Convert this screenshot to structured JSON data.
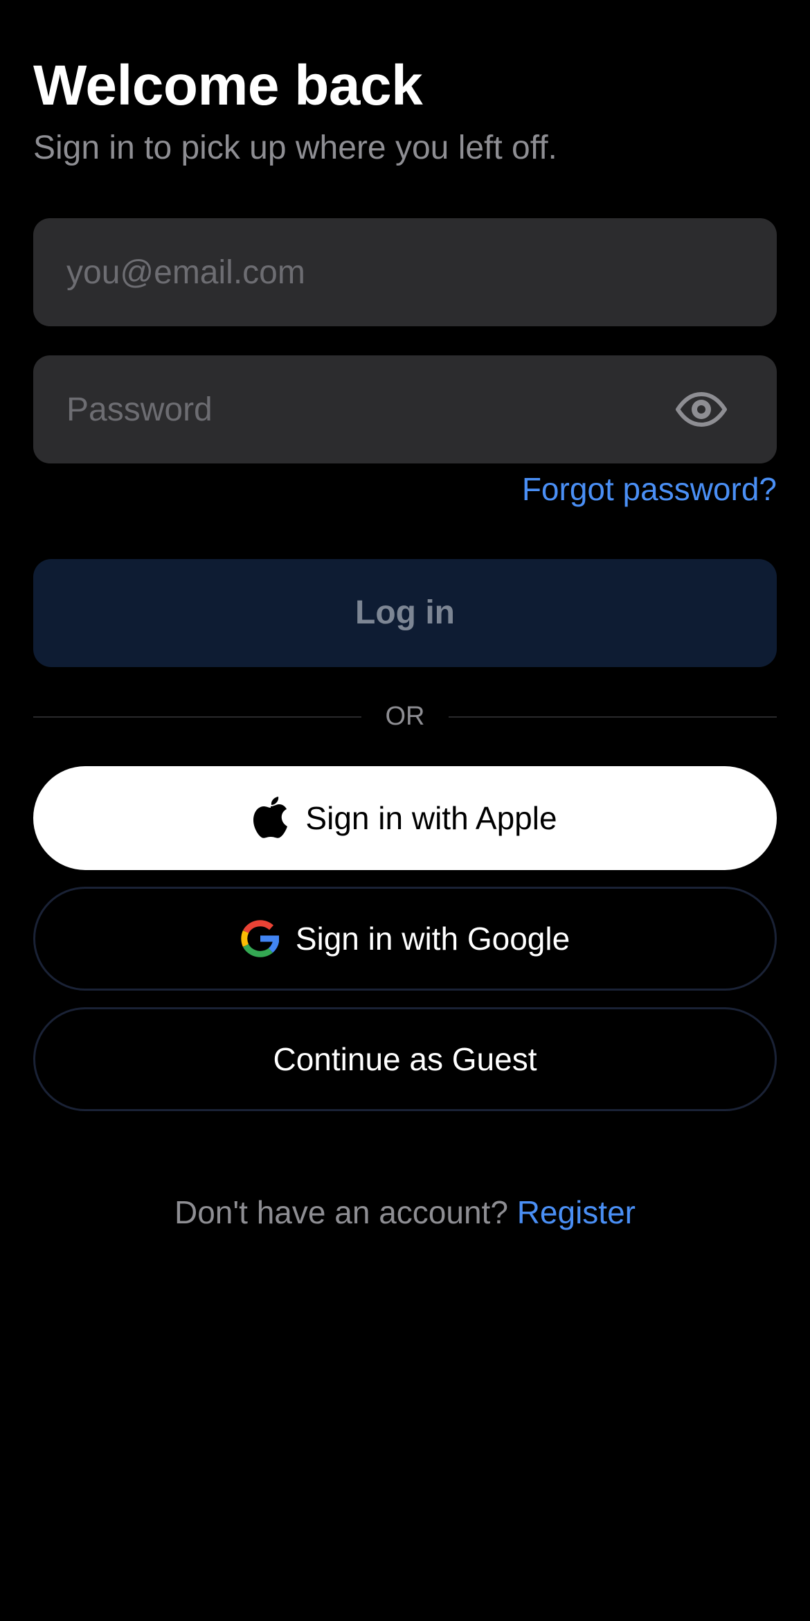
{
  "header": {
    "title": "Welcome back",
    "subtitle": "Sign in to pick up where you left off."
  },
  "form": {
    "email_placeholder": "you@email.com",
    "email_value": "",
    "password_placeholder": "Password",
    "password_value": "",
    "password_toggle_icon": "eye-icon",
    "forgot_link": "Forgot password?",
    "login_label": "Log in"
  },
  "divider": {
    "label": "OR"
  },
  "social": {
    "apple_label": "Sign in with Apple",
    "apple_icon": "apple-logo-icon",
    "google_label": "Sign in with Google",
    "google_icon": "google-logo-icon",
    "guest_label": "Continue as Guest"
  },
  "footer": {
    "prompt": "Don't have an account?",
    "register_link": "Register"
  },
  "colors": {
    "background": "#000000",
    "field_background": "#2c2c2e",
    "accent": "#4a8ff5",
    "login_disabled_bg": "#0e1c33",
    "secondary_text": "#8e8e93",
    "outline_border": "#1a2236"
  }
}
